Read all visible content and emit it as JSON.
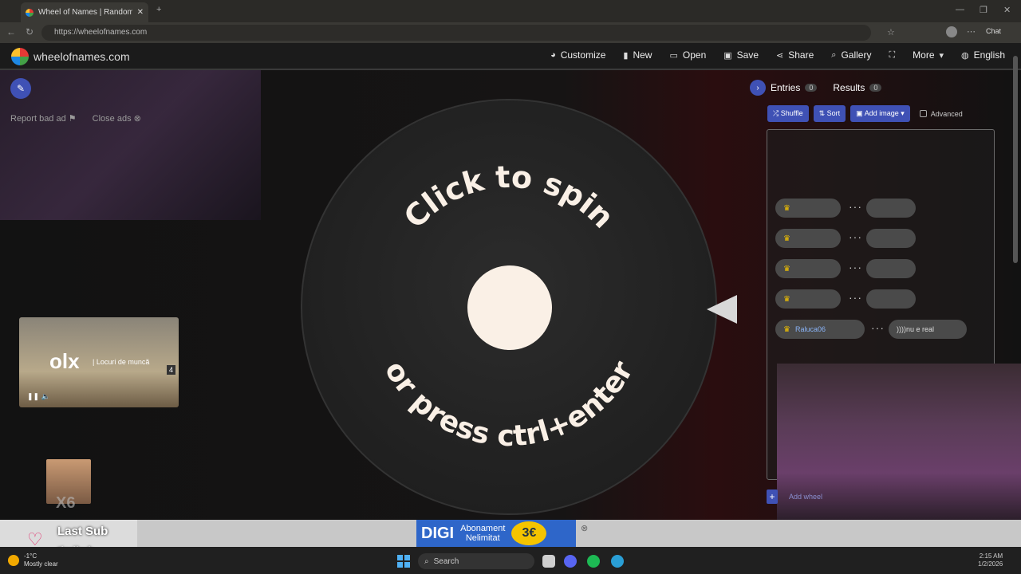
{
  "browser": {
    "tab_title": "Wheel of Names | Random name",
    "url": "https://wheelofnames.com",
    "chat_label": "Chat",
    "min": "—",
    "max": "❐",
    "close": "✕",
    "new_tab": "+"
  },
  "header": {
    "logo_text": "wheelofnames.com",
    "menu": [
      {
        "icon": "palette-icon",
        "label": "Customize"
      },
      {
        "icon": "file-icon",
        "label": "New"
      },
      {
        "icon": "folder-icon",
        "label": "Open"
      },
      {
        "icon": "save-icon",
        "label": "Save"
      },
      {
        "icon": "share-icon",
        "label": "Share"
      },
      {
        "icon": "search-icon",
        "label": "Gallery"
      },
      {
        "icon": "fullscreen-icon",
        "label": ""
      },
      {
        "icon": "chevron-down-icon",
        "label": "More"
      },
      {
        "icon": "globe-icon",
        "label": "English"
      }
    ]
  },
  "ads": {
    "report": "Report bad ad",
    "close": "Close ads",
    "olx_brand": "olx",
    "olx_sub": "| Locuri de muncă",
    "olx_count": "4"
  },
  "wheel": {
    "top_text": "Click to spin",
    "bottom_text": "or press ctrl+enter"
  },
  "panel": {
    "entries_label": "Entries",
    "entries_count": "0",
    "results_label": "Results",
    "results_count": "0",
    "shuffle": "Shuffle",
    "sort": "Sort",
    "add_image": "Add image",
    "advanced": "Advanced",
    "add_wheel": "Add wheel",
    "chip_name": "Raluca06",
    "chip_extra": "))))nu e real"
  },
  "overlay": {
    "last_sub_label": "Last Sub",
    "last_sub_name": "timihxh",
    "multiplier": "X6"
  },
  "digi_ad": {
    "brand": "DIGI",
    "line1": "Abonament",
    "line2": "Nelimitat",
    "price": "3€"
  },
  "taskbar": {
    "temp": "-1°C",
    "weather": "Mostly clear",
    "search": "Search",
    "time": "2:15 AM",
    "date": "1/2/2026"
  },
  "colors": {
    "accent": "#3f51b5",
    "hub": "#faf0e6",
    "wheel": "#262626"
  }
}
